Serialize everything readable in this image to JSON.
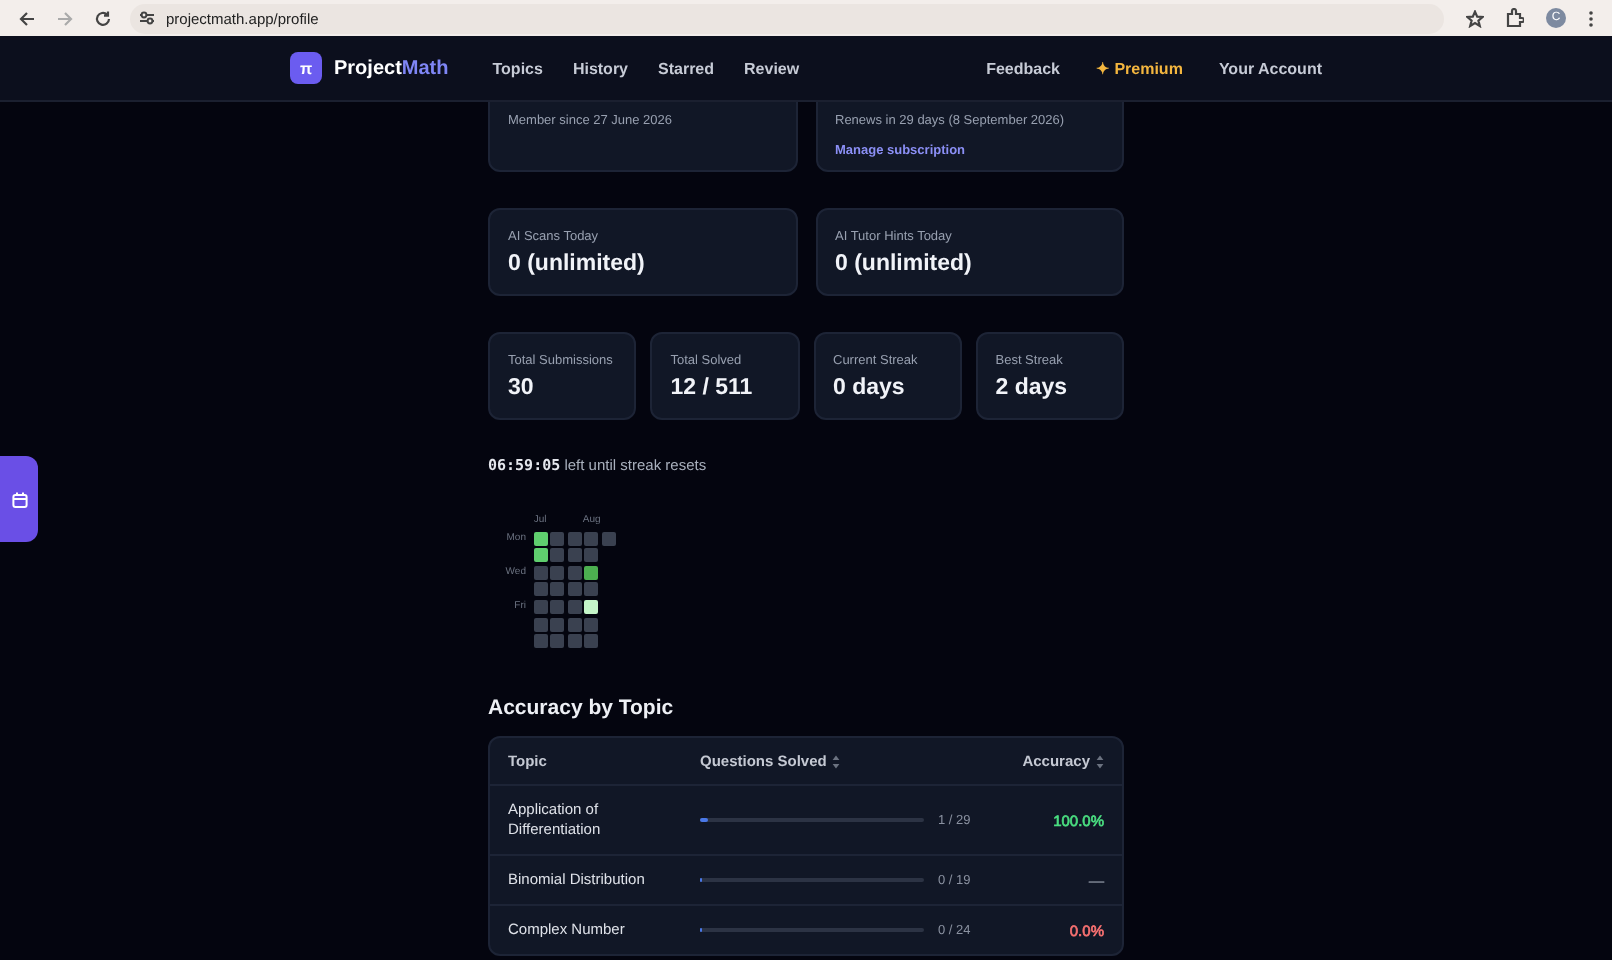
{
  "browser": {
    "url": "projectmath.app/profile",
    "avatar": "C"
  },
  "nav": {
    "logo_mark": "π",
    "brand": "Project",
    "brand_accent": "Math",
    "links": [
      {
        "label": "Topics"
      },
      {
        "label": "History"
      },
      {
        "label": "Starred"
      },
      {
        "label": "Review"
      }
    ],
    "right_links": [
      {
        "label": "Feedback",
        "kind": "plain"
      },
      {
        "label": "Premium",
        "kind": "premium",
        "mark": "✦"
      },
      {
        "label": "Your Account",
        "kind": "plain"
      }
    ]
  },
  "membership": [
    {
      "text": "Member since 27 June 2026"
    },
    {
      "text": "Renews in 29 days (8 September 2026)",
      "link": "Manage subscription"
    }
  ],
  "usage": [
    {
      "label": "AI Scans Today",
      "value": "0 (unlimited)"
    },
    {
      "label": "AI Tutor Hints Today",
      "value": "0 (unlimited)"
    }
  ],
  "stats": [
    {
      "label": "Total Submissions",
      "value": "30"
    },
    {
      "label": "Total Solved",
      "value": "12 / 511"
    },
    {
      "label": "Current Streak",
      "value": "0 days"
    },
    {
      "label": "Best Streak",
      "value": "2 days"
    }
  ],
  "streak": {
    "countdown": "06:59:05",
    "text": "left until streak resets"
  },
  "heatmap": {
    "days": [
      "Mon",
      "Wed",
      "Fri"
    ],
    "weeks": [
      {
        "month": "Jul",
        "cells": [
          {
            "color": "#5fcf6e"
          },
          {
            "color": "#5fcf6e"
          },
          {
            "color": "#3a4150"
          },
          {
            "color": "#3a4150"
          },
          {
            "color": "#3a4150"
          },
          {
            "color": "#3a4150"
          },
          {
            "color": "#3a4150"
          }
        ]
      },
      {
        "cells": [
          {
            "color": "#3a4150"
          },
          {
            "color": "#3a4150"
          },
          {
            "color": "#3a4150"
          },
          {
            "color": "#3a4150"
          },
          {
            "color": "#3a4150"
          },
          {
            "color": "#3a4150"
          },
          {
            "color": "#3a4150"
          }
        ]
      },
      {
        "cells": [
          {
            "color": "#3a4150"
          },
          {
            "color": "#3a4150"
          },
          {
            "color": "#3a4150"
          },
          {
            "color": "#3a4150"
          },
          {
            "color": "#3a4150"
          },
          {
            "color": "#3a4150"
          },
          {
            "color": "#3a4150"
          }
        ]
      },
      {
        "month": "Aug",
        "cells": [
          {
            "color": "#3a4150"
          },
          {
            "color": "#3a4150"
          },
          {
            "color": "#4caf50"
          },
          {
            "color": "#3a4150"
          },
          {
            "color": "#c4f5c8"
          },
          {
            "color": "#3a4150"
          },
          {
            "color": "#3a4150"
          }
        ]
      },
      {
        "cells": [
          {
            "color": "#3a4150"
          }
        ]
      }
    ]
  },
  "accuracy": {
    "title": "Accuracy by Topic",
    "columns": [
      {
        "label": "Topic",
        "sortable": false
      },
      {
        "label": "Questions Solved",
        "sortable": true
      },
      {
        "label": "Accuracy",
        "sortable": true
      }
    ],
    "rows": [
      {
        "topic": "Application of Differentiation",
        "solved": "1 / 29",
        "level": 0.034,
        "accuracy": "100.0%",
        "color": "#4ade80"
      },
      {
        "topic": "Binomial Distribution",
        "solved": "0 / 19",
        "level": 0,
        "accuracy": "—",
        "color": "#6b7280"
      },
      {
        "topic": "Complex Number",
        "solved": "0 / 24",
        "level": 0,
        "accuracy": "0.0%",
        "color": "#f87171"
      }
    ]
  }
}
